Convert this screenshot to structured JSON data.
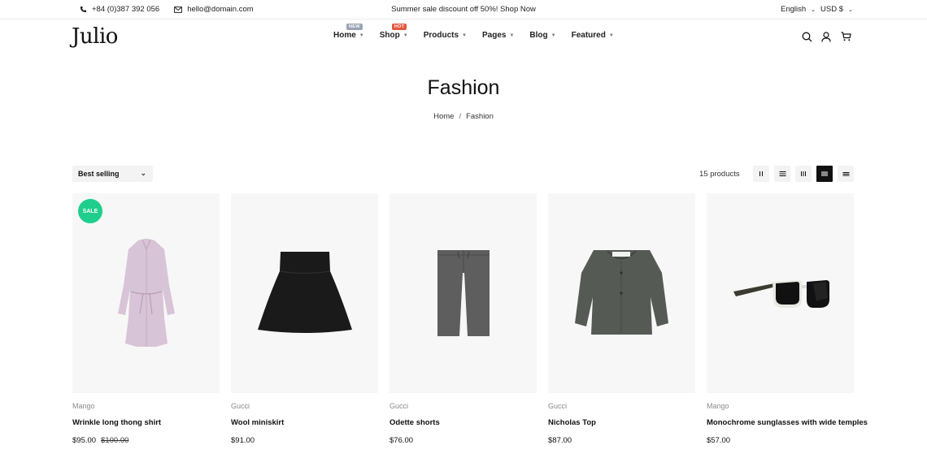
{
  "topbar": {
    "phone": "+84 (0)387 392 056",
    "email": "hello@domain.com",
    "promo": "Summer sale discount off 50%! Shop Now",
    "language": "English",
    "currency": "USD $"
  },
  "header": {
    "logo": "Julio",
    "nav": [
      {
        "label": "Home",
        "badge": "NEW",
        "badge_color": "#9aa3b5"
      },
      {
        "label": "Shop",
        "badge": "HOT",
        "badge_color": "#e4573d"
      },
      {
        "label": "Products"
      },
      {
        "label": "Pages"
      },
      {
        "label": "Blog"
      },
      {
        "label": "Featured"
      }
    ],
    "icons": [
      "search-icon",
      "user-icon",
      "cart-icon"
    ]
  },
  "page": {
    "title": "Fashion",
    "breadcrumb": {
      "home": "Home",
      "separator": "/",
      "current": "Fashion"
    }
  },
  "toolbar": {
    "sort_label": "Best selling",
    "product_count": "15 products",
    "views": [
      "grid-2-icon",
      "list-icon",
      "grid-3-icon",
      "grid-4-icon",
      "grid-5-icon"
    ],
    "active_view": 3
  },
  "products": [
    {
      "brand": "Mango",
      "name": "Wrinkle long thong shirt",
      "price": "$95.00",
      "old_price": "$100.00",
      "badge": "SALE"
    },
    {
      "brand": "Gucci",
      "name": "Wool miniskirt",
      "price": "$91.00"
    },
    {
      "brand": "Gucci",
      "name": "Odette shorts",
      "price": "$76.00"
    },
    {
      "brand": "Gucci",
      "name": "Nicholas Top",
      "price": "$87.00"
    },
    {
      "brand": "Mango",
      "name": "Monochrome sunglasses with wide temples",
      "price": "$57.00"
    }
  ],
  "colors": {
    "sale_badge": "#1fce8d",
    "image_bg": "#f7f7f7",
    "text": "#111111"
  }
}
